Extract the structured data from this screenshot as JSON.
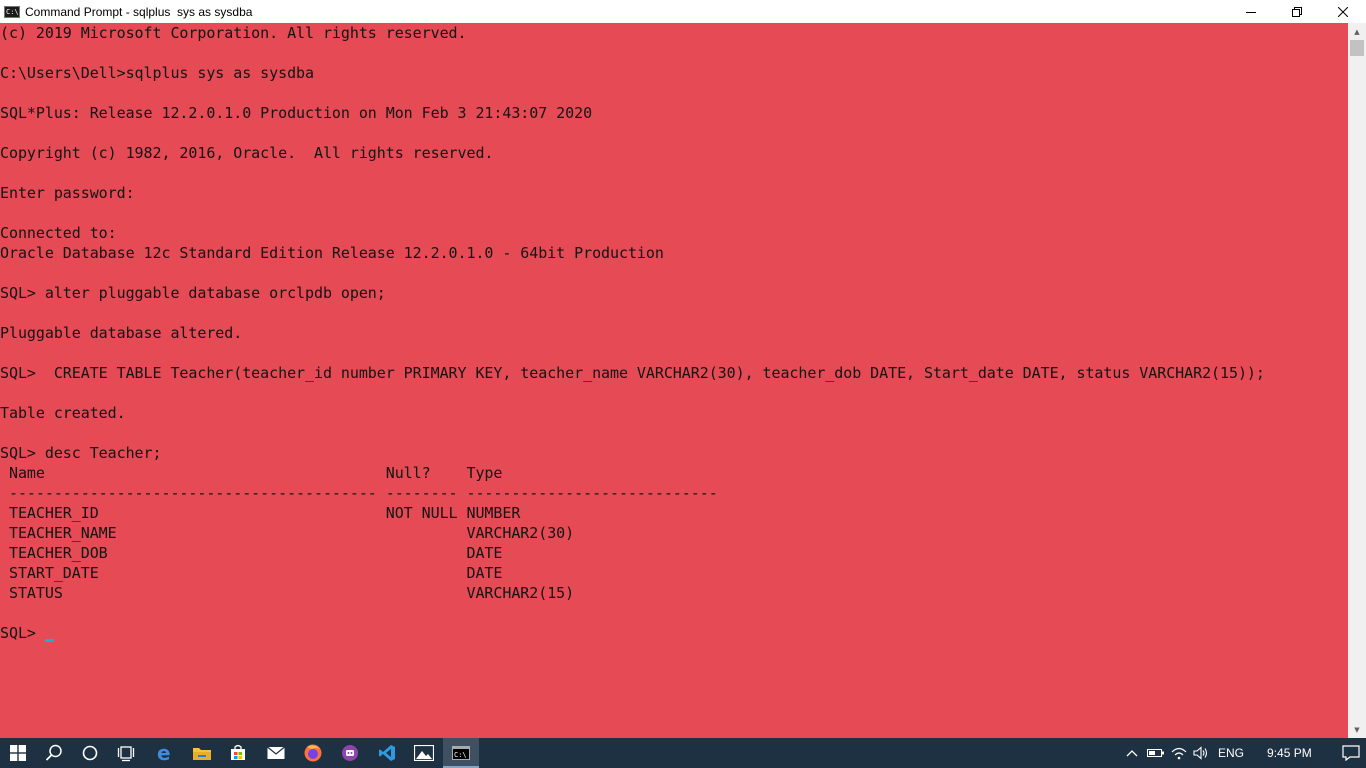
{
  "window": {
    "title": "Command Prompt - sqlplus  sys as sysdba",
    "app_icon_text": "C:\\"
  },
  "console": {
    "lines": [
      "(c) 2019 Microsoft Corporation. All rights reserved.",
      "",
      "C:\\Users\\Dell>sqlplus sys as sysdba",
      "",
      "SQL*Plus: Release 12.2.0.1.0 Production on Mon Feb 3 21:43:07 2020",
      "",
      "Copyright (c) 1982, 2016, Oracle.  All rights reserved.",
      "",
      "Enter password:",
      "",
      "Connected to:",
      "Oracle Database 12c Standard Edition Release 12.2.0.1.0 - 64bit Production",
      "",
      "SQL> alter pluggable database orclpdb open;",
      "",
      "Pluggable database altered.",
      "",
      "SQL>  CREATE TABLE Teacher(teacher_id number PRIMARY KEY, teacher_name VARCHAR2(30), teacher_dob DATE, Start_date DATE, status VARCHAR2(15));",
      "",
      "Table created.",
      "",
      "SQL> desc Teacher;",
      " Name                                      Null?    Type",
      " ----------------------------------------- -------- ----------------------------",
      " TEACHER_ID                                NOT NULL NUMBER",
      " TEACHER_NAME                                       VARCHAR2(30)",
      " TEACHER_DOB                                        DATE",
      " START_DATE                                         DATE",
      " STATUS                                             VARCHAR2(15)",
      "",
      "SQL> "
    ]
  },
  "taskbar": {
    "apps": [
      {
        "name": "search-icon"
      },
      {
        "name": "cortana-icon"
      },
      {
        "name": "task-view-icon"
      },
      {
        "name": "edge-icon"
      },
      {
        "name": "file-explorer-icon"
      },
      {
        "name": "store-icon"
      },
      {
        "name": "mail-icon"
      },
      {
        "name": "firefox-icon"
      },
      {
        "name": "purple-app-icon"
      },
      {
        "name": "vscode-icon"
      },
      {
        "name": "photos-icon"
      },
      {
        "name": "command-prompt-icon"
      }
    ],
    "tray": {
      "language": "ENG",
      "time": "9:45 PM"
    }
  },
  "colors": {
    "console_bg": "#e54a55",
    "console_text": "#141414",
    "cursor": "#1fb0b8",
    "taskbar_bg": "#1e3142"
  }
}
